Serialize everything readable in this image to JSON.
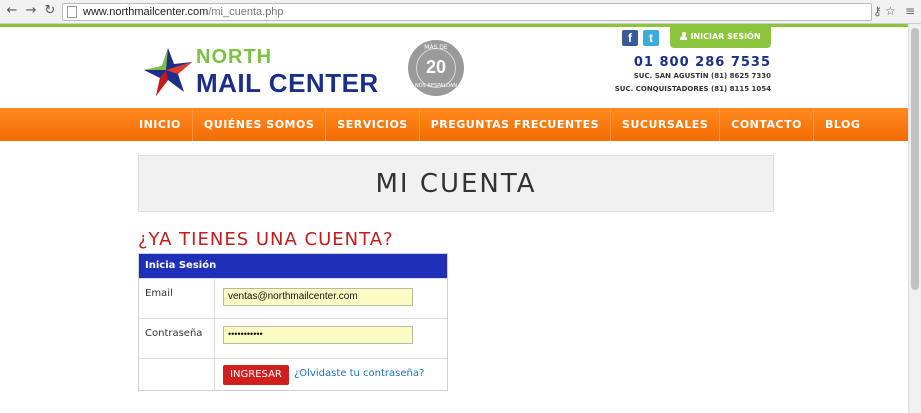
{
  "browser": {
    "url_host": "www.northmailcenter.com",
    "url_path": "/mi_cuenta.php",
    "back_icon": "back-arrow-icon",
    "forward_icon": "forward-arrow-icon",
    "reload_icon": "reload-icon"
  },
  "header": {
    "logo_line1": "NORTH",
    "logo_line2": "MAIL CENTER",
    "badge_top": "MÁS DE",
    "badge_number": "20",
    "badge_bottom": "NOS RESPALDAN",
    "login_label": "INICIAR SESIÓN",
    "phone": "01 800 286 7535",
    "branch_1": "SUC. SAN AGUSTÍN (81) 8625 7330",
    "branch_2": "SUC. CONQUISTADORES (81) 8115 1054"
  },
  "nav": {
    "items": [
      "INICIO",
      "QUIÉNES SOMOS",
      "SERVICIOS",
      "PREGUNTAS FRECUENTES",
      "SUCURSALES",
      "CONTACTO",
      "BLOG"
    ]
  },
  "main": {
    "page_title": "MI CUENTA",
    "section_heading": "¿YA TIENES UNA CUENTA?",
    "form": {
      "header": "Inicia Sesión",
      "email_label": "Email",
      "email_value": "ventas@northmailcenter.com",
      "password_label": "Contraseña",
      "password_value": "•••••••••••",
      "submit_label": "INGRESAR",
      "forgot_link": "¿Olvidaste tu contraseña?"
    }
  },
  "colors": {
    "green": "#8cc43c",
    "orange": "#f26c05",
    "blue": "#1f2fb8",
    "red": "#c21b1b"
  }
}
